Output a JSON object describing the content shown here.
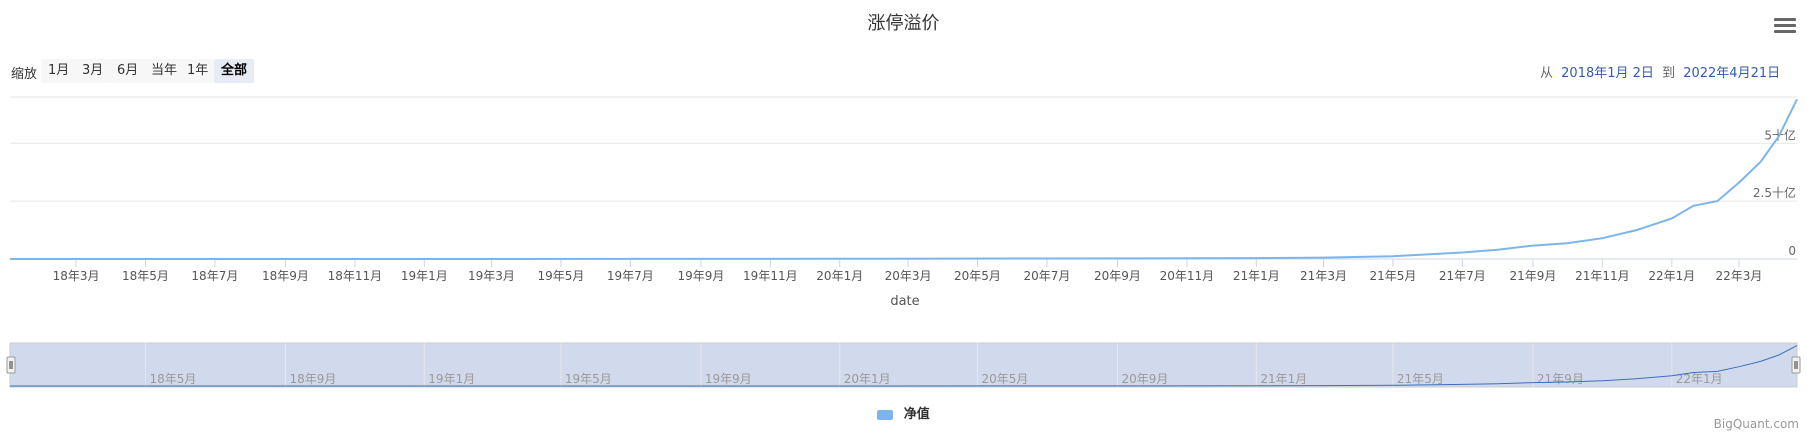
{
  "chart_data": {
    "type": "line",
    "title": "涨停溢价",
    "xlabel": "date",
    "x_date_range": [
      "2018-01-02",
      "2022-04-21"
    ],
    "ylim": [
      0,
      7000000000
    ],
    "y_ticks": [
      {
        "value": 0,
        "label": "0"
      },
      {
        "value": 2500000000,
        "label": "2.5十亿"
      },
      {
        "value": 5000000000,
        "label": "5十亿"
      }
    ],
    "x_ticks": [
      {
        "date": "2018-03-01",
        "label": "18年3月"
      },
      {
        "date": "2018-05-01",
        "label": "18年5月"
      },
      {
        "date": "2018-07-01",
        "label": "18年7月"
      },
      {
        "date": "2018-09-01",
        "label": "18年9月"
      },
      {
        "date": "2018-11-01",
        "label": "18年11月"
      },
      {
        "date": "2019-01-01",
        "label": "19年1月"
      },
      {
        "date": "2019-03-01",
        "label": "19年3月"
      },
      {
        "date": "2019-05-01",
        "label": "19年5月"
      },
      {
        "date": "2019-07-01",
        "label": "19年7月"
      },
      {
        "date": "2019-09-01",
        "label": "19年9月"
      },
      {
        "date": "2019-11-01",
        "label": "19年11月"
      },
      {
        "date": "2020-01-01",
        "label": "20年1月"
      },
      {
        "date": "2020-03-01",
        "label": "20年3月"
      },
      {
        "date": "2020-05-01",
        "label": "20年5月"
      },
      {
        "date": "2020-07-01",
        "label": "20年7月"
      },
      {
        "date": "2020-09-01",
        "label": "20年9月"
      },
      {
        "date": "2020-11-01",
        "label": "20年11月"
      },
      {
        "date": "2021-01-01",
        "label": "21年1月"
      },
      {
        "date": "2021-03-01",
        "label": "21年3月"
      },
      {
        "date": "2021-05-01",
        "label": "21年5月"
      },
      {
        "date": "2021-07-01",
        "label": "21年7月"
      },
      {
        "date": "2021-09-01",
        "label": "21年9月"
      },
      {
        "date": "2021-11-01",
        "label": "21年11月"
      },
      {
        "date": "2022-01-01",
        "label": "22年1月"
      },
      {
        "date": "2022-03-01",
        "label": "22年3月"
      }
    ],
    "navigator_ticks": [
      {
        "date": "2018-05-01",
        "label": "18年5月"
      },
      {
        "date": "2018-09-01",
        "label": "18年9月"
      },
      {
        "date": "2019-01-01",
        "label": "19年1月"
      },
      {
        "date": "2019-05-01",
        "label": "19年5月"
      },
      {
        "date": "2019-09-01",
        "label": "19年9月"
      },
      {
        "date": "2020-01-01",
        "label": "20年1月"
      },
      {
        "date": "2020-05-01",
        "label": "20年5月"
      },
      {
        "date": "2020-09-01",
        "label": "20年9月"
      },
      {
        "date": "2021-01-01",
        "label": "21年1月"
      },
      {
        "date": "2021-05-01",
        "label": "21年5月"
      },
      {
        "date": "2021-09-01",
        "label": "21年9月"
      },
      {
        "date": "2022-01-01",
        "label": "22年1月"
      }
    ],
    "series": [
      {
        "name": "净值",
        "color": "#7cb5ec",
        "points": [
          [
            "2018-01-02",
            0
          ],
          [
            "2019-01-01",
            2000000
          ],
          [
            "2020-01-01",
            8000000
          ],
          [
            "2020-07-01",
            20000000
          ],
          [
            "2021-01-01",
            40000000
          ],
          [
            "2021-03-01",
            60000000
          ],
          [
            "2021-05-01",
            120000000
          ],
          [
            "2021-07-01",
            280000000
          ],
          [
            "2021-08-01",
            400000000
          ],
          [
            "2021-09-01",
            580000000
          ],
          [
            "2021-10-01",
            680000000
          ],
          [
            "2021-11-01",
            900000000
          ],
          [
            "2021-12-01",
            1250000000
          ],
          [
            "2022-01-01",
            1750000000
          ],
          [
            "2022-01-20",
            2300000000
          ],
          [
            "2022-02-10",
            2500000000
          ],
          [
            "2022-03-01",
            3300000000
          ],
          [
            "2022-03-20",
            4200000000
          ],
          [
            "2022-04-05",
            5300000000
          ],
          [
            "2022-04-21",
            6900000000
          ]
        ]
      }
    ]
  },
  "controls": {
    "zoom_label": "缩放",
    "zoom_buttons": [
      "1月",
      "3月",
      "6月",
      "当年",
      "1年",
      "全部"
    ],
    "active_zoom": "全部",
    "range_from_label": "从",
    "range_from": "2018年1月 2日",
    "range_to_label": "到",
    "range_to": "2022年4月21日"
  },
  "credit": "BigQuant.com"
}
